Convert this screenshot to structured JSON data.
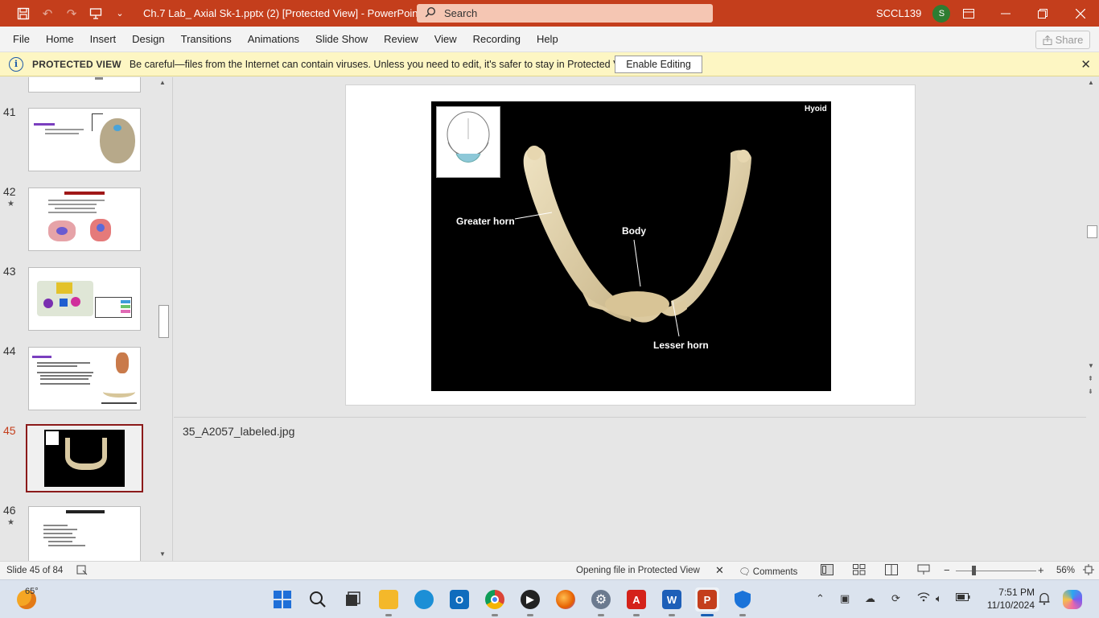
{
  "titlebar": {
    "doc_title": "Ch.7 Lab_ Axial Sk-1.pptx (2) [Protected View]  -  PowerPoint",
    "search_placeholder": "Search",
    "user_name": "SCCL139",
    "avatar_initial": "S",
    "accent_color": "#c43e1c"
  },
  "menu": {
    "items": [
      "File",
      "Home",
      "Insert",
      "Design",
      "Transitions",
      "Animations",
      "Slide Show",
      "Review",
      "View",
      "Recording",
      "Help"
    ],
    "share_label": "Share"
  },
  "protected_view": {
    "title": "PROTECTED VIEW",
    "message": "Be careful—files from the Internet can contain viruses. Unless you need to edit, it's safer to stay in Protected View.",
    "enable_button": "Enable Editing"
  },
  "thumbnails": [
    {
      "num": "41",
      "star": false
    },
    {
      "num": "42",
      "star": true
    },
    {
      "num": "43",
      "star": false
    },
    {
      "num": "44",
      "star": false
    },
    {
      "num": "45",
      "star": false,
      "selected": true
    },
    {
      "num": "46",
      "star": true
    }
  ],
  "slide": {
    "title_label": "Hyoid",
    "labels": {
      "greater_horn": "Greater horn",
      "body": "Body",
      "lesser_horn": "Lesser horn"
    }
  },
  "notes": {
    "text": "35_A2057_labeled.jpg"
  },
  "statusbar": {
    "slide_info": "Slide 45 of 84",
    "message": "Opening file in Protected View",
    "comments_label": "Comments",
    "zoom": "56%"
  },
  "taskbar": {
    "weather": "65°",
    "time": "7:51 PM",
    "date": "11/10/2024"
  }
}
